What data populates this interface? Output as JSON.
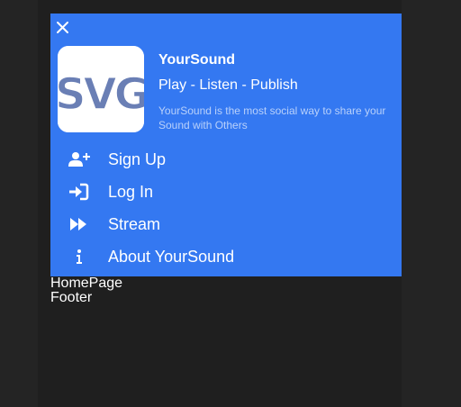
{
  "app": {
    "name": "YourSound",
    "tagline": "Play - Listen - Publish",
    "description": "YourSound is the most social way to share your Sound with Others",
    "logo_text": "SVG"
  },
  "menu": {
    "items": [
      {
        "label": "Sign Up",
        "icon": "user-plus-icon"
      },
      {
        "label": "Log In",
        "icon": "sign-in-icon"
      },
      {
        "label": "Stream",
        "icon": "fast-forward-icon"
      },
      {
        "label": "About YourSound",
        "icon": "info-icon"
      }
    ]
  },
  "page": {
    "home": "HomePage",
    "footer": "Footer"
  },
  "colors": {
    "panel": "#3478f1",
    "background": "#242424",
    "logo": "#6a7fb5"
  }
}
